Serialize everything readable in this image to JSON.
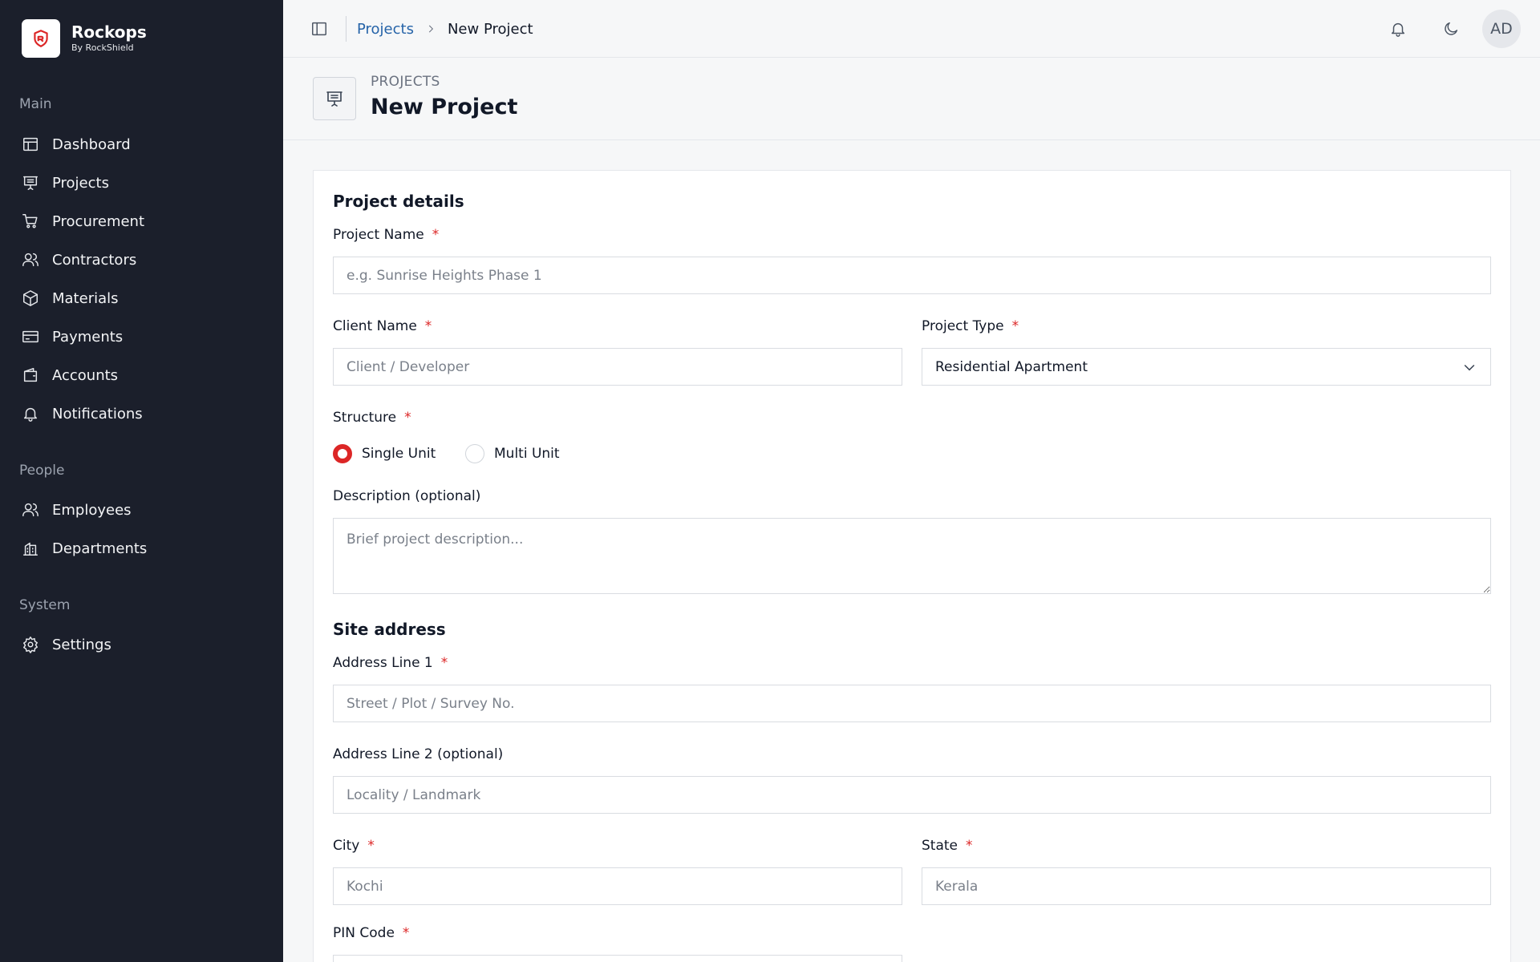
{
  "brand": {
    "name": "Rockops",
    "sub": "By RockShield"
  },
  "sidebar": {
    "groups": [
      {
        "label": "Main",
        "items": [
          {
            "label": "Dashboard",
            "icon": "dashboard-icon"
          },
          {
            "label": "Projects",
            "icon": "projects-icon"
          },
          {
            "label": "Procurement",
            "icon": "cart-icon"
          },
          {
            "label": "Contractors",
            "icon": "users-icon"
          },
          {
            "label": "Materials",
            "icon": "box-icon"
          },
          {
            "label": "Payments",
            "icon": "card-icon"
          },
          {
            "label": "Accounts",
            "icon": "wallet-icon"
          },
          {
            "label": "Notifications",
            "icon": "bell-icon"
          }
        ]
      },
      {
        "label": "People",
        "items": [
          {
            "label": "Employees",
            "icon": "users-icon"
          },
          {
            "label": "Departments",
            "icon": "building-icon"
          }
        ]
      },
      {
        "label": "System",
        "items": [
          {
            "label": "Settings",
            "icon": "gear-icon"
          }
        ]
      }
    ]
  },
  "header": {
    "breadcrumb": {
      "parent": "Projects",
      "current": "New Project"
    },
    "avatar": "AD"
  },
  "page": {
    "kicker": "PROJECTS",
    "title": "New Project"
  },
  "form": {
    "details_title": "Project details",
    "project_name": {
      "label": "Project Name",
      "required": "*",
      "placeholder": "e.g. Sunrise Heights Phase 1",
      "value": ""
    },
    "client_name": {
      "label": "Client Name",
      "required": "*",
      "placeholder": "Client / Developer",
      "value": ""
    },
    "project_type": {
      "label": "Project Type",
      "required": "*",
      "value": "Residential Apartment"
    },
    "structure": {
      "label": "Structure",
      "required": "*",
      "options": [
        "Single Unit",
        "Multi Unit"
      ],
      "selected": "Single Unit"
    },
    "description": {
      "label": "Description (optional)",
      "placeholder": "Brief project description..."
    },
    "address_title": "Site address",
    "address1": {
      "label": "Address Line 1",
      "required": "*",
      "placeholder": "Street / Plot / Survey No."
    },
    "address2": {
      "label": "Address Line 2 (optional)",
      "placeholder": "Locality / Landmark"
    },
    "city": {
      "label": "City",
      "required": "*",
      "placeholder": "Kochi"
    },
    "state": {
      "label": "State",
      "required": "*",
      "placeholder": "Kerala"
    },
    "pin": {
      "label": "PIN Code",
      "required": "*"
    }
  },
  "colors": {
    "sidebar": "#1b1f2b",
    "accent": "#dc2626",
    "link": "#2563a8"
  }
}
